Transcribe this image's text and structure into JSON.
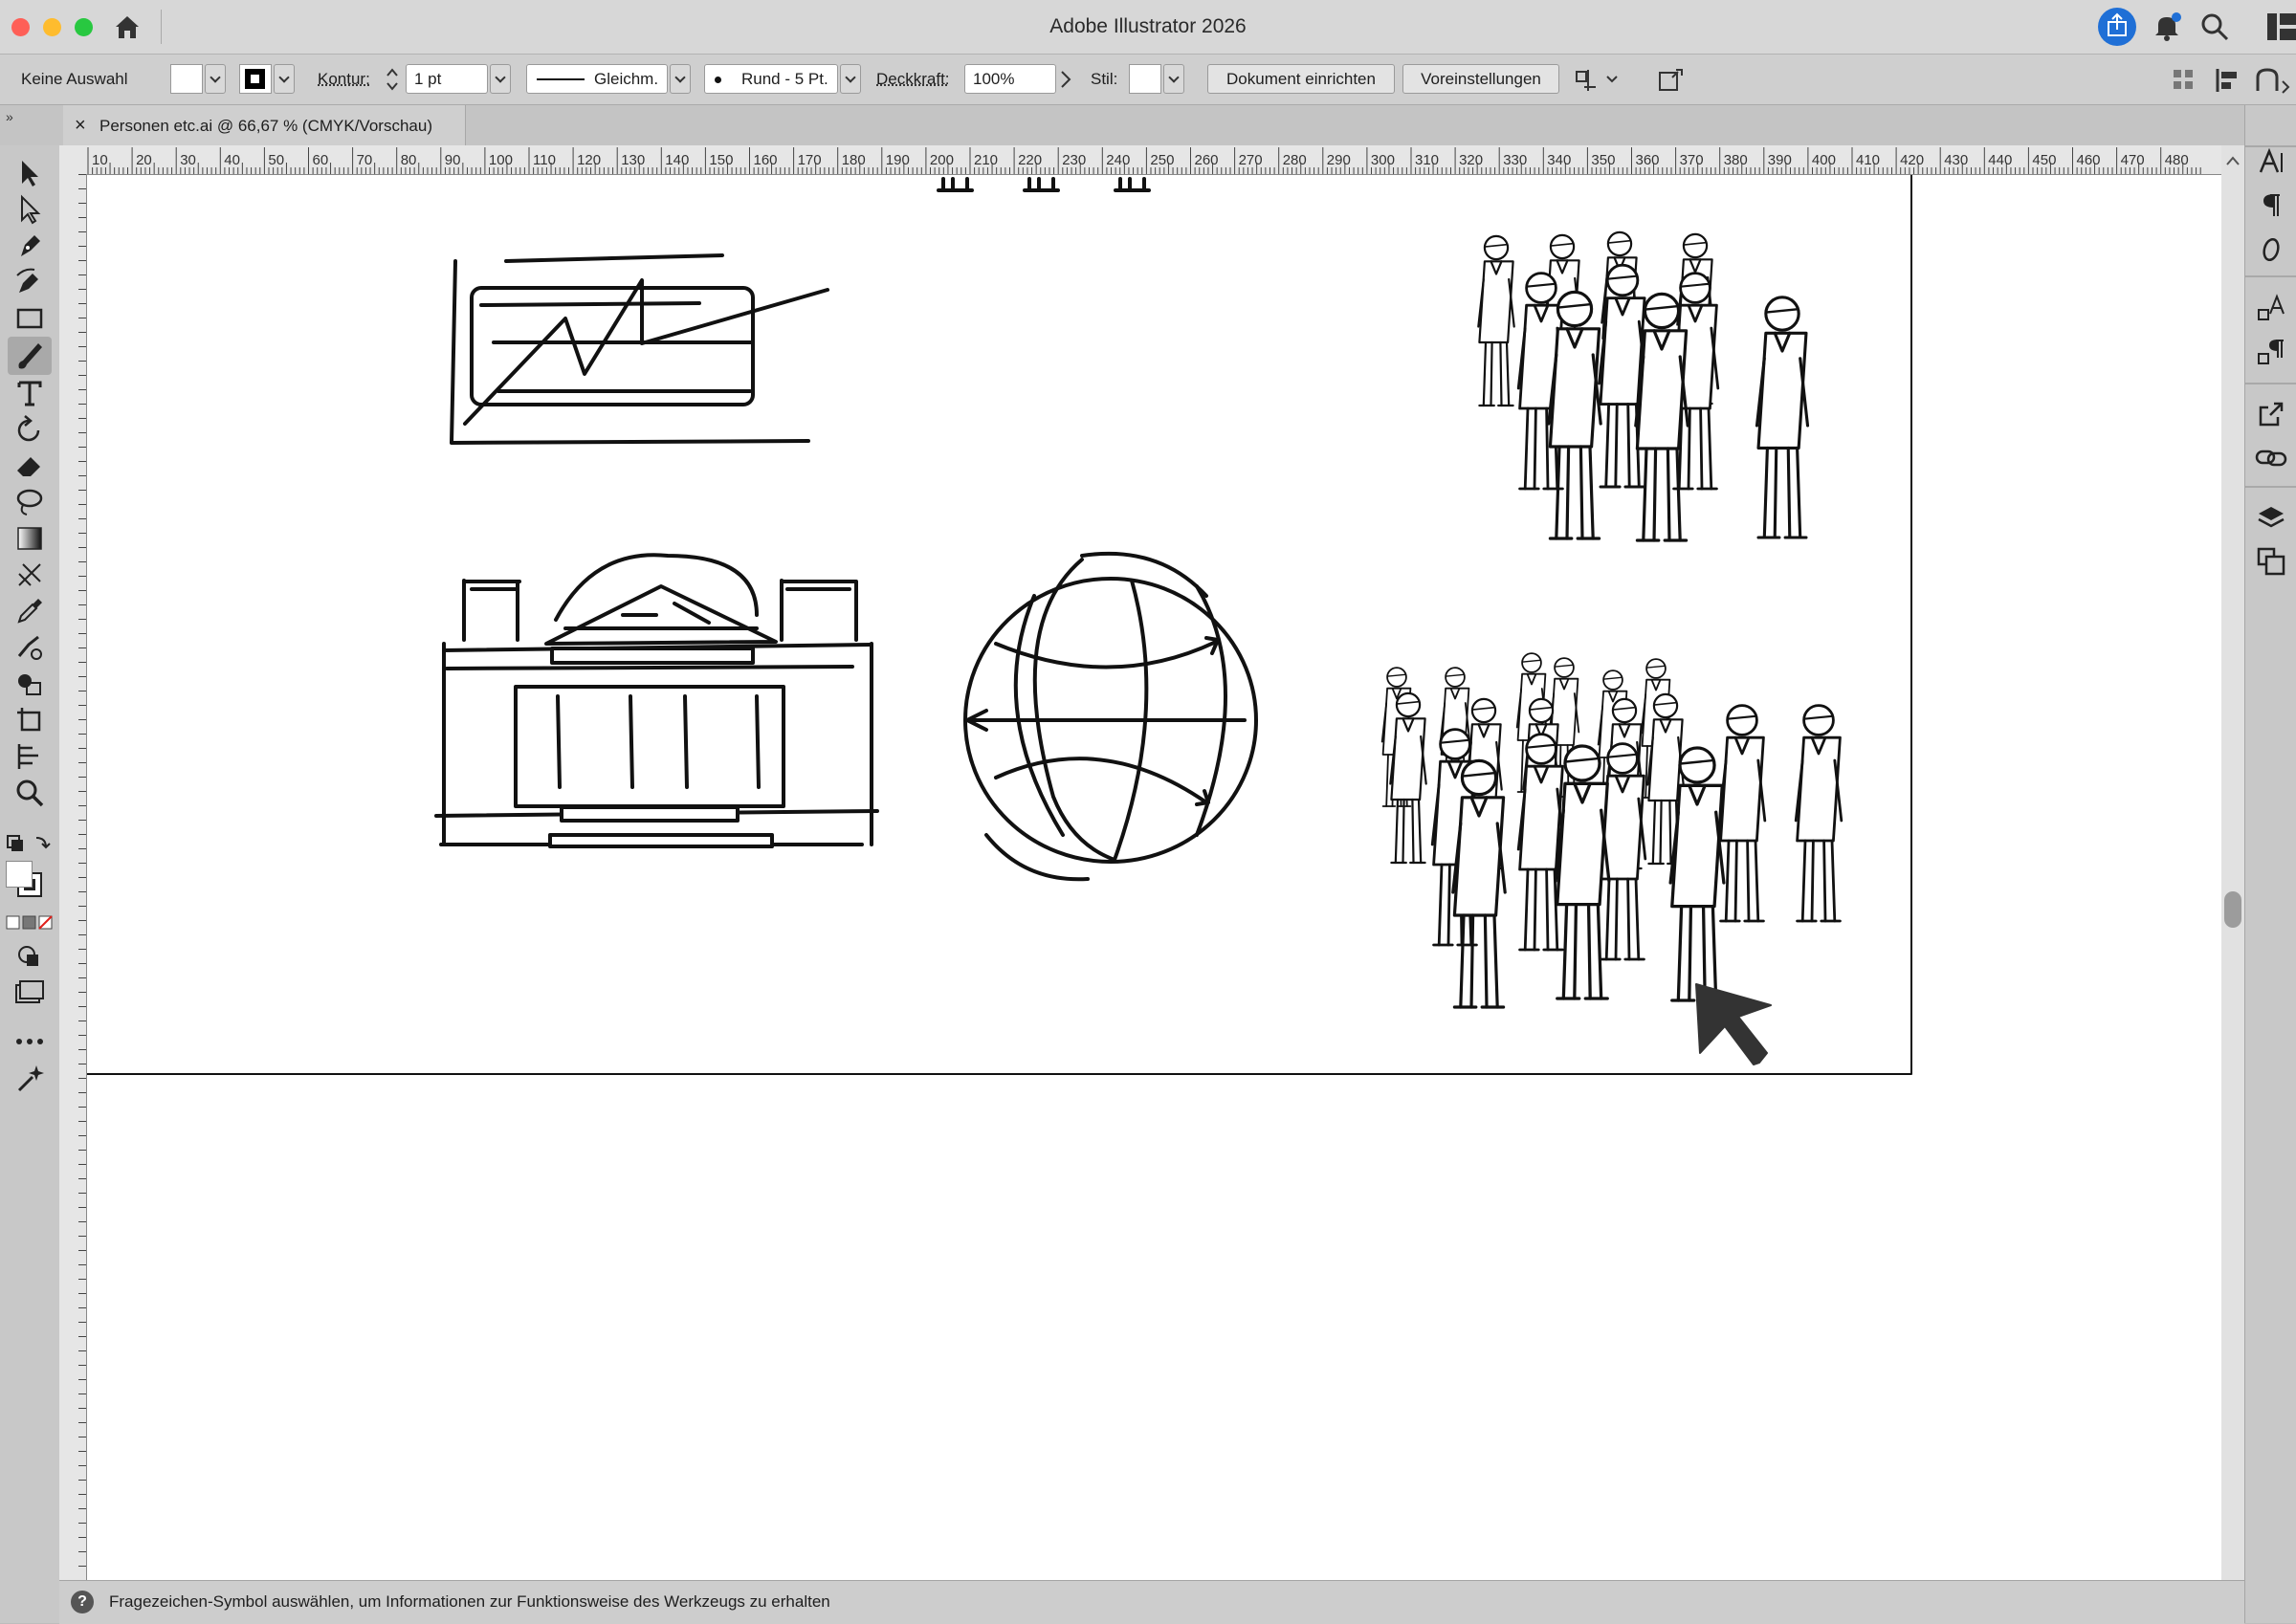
{
  "app": {
    "title": "Adobe Illustrator 2026"
  },
  "colors": {
    "close": "#fe5f57",
    "minimize": "#febc2e",
    "zoom": "#28c840",
    "accent": "#1f6fd6"
  },
  "controlbar": {
    "selection": "Keine Auswahl",
    "stroke_label": "Kontur:",
    "stroke_weight": "1 pt",
    "stroke_profile": "Gleichm.",
    "brush": "Rund - 5 Pt.",
    "opacity_label": "Deckkraft:",
    "opacity_value": "100%",
    "style_label": "Stil:",
    "document_setup_button": "Dokument einrichten",
    "preferences_button": "Voreinstellungen"
  },
  "document": {
    "tab_title": "Personen etc.ai @ 66,67 % (CMYK/Vorschau)",
    "close_glyph": "×"
  },
  "ruler": {
    "top_labels": [
      "10",
      "20",
      "30",
      "40",
      "50",
      "60",
      "70",
      "80",
      "90",
      "100",
      "110",
      "120",
      "130",
      "140",
      "150",
      "160",
      "170",
      "180",
      "190",
      "200",
      "210",
      "220",
      "230",
      "240",
      "250",
      "260",
      "270",
      "280",
      "290",
      "300",
      "310",
      "320",
      "330",
      "340",
      "350",
      "360",
      "370",
      "380",
      "390",
      "400",
      "410",
      "420",
      "430",
      "440",
      "450",
      "460",
      "470",
      "480"
    ]
  },
  "statusbar": {
    "help_icon_glyph": "?",
    "message": "Fragezeichen-Symbol auswählen, um Informationen zur Funktionsweise des Werkzeugs zu erhalten"
  },
  "tools": [
    "selection-tool",
    "direct-selection-tool",
    "pen-tool",
    "curvature-tool",
    "rectangle-tool",
    "paintbrush-tool",
    "type-tool",
    "rotate-tool",
    "eraser-tool",
    "lasso-tool",
    "gradient-tool",
    "mesh-tool",
    "eyedropper-tool",
    "blend-tool",
    "shape-builder-tool",
    "artboard-tool",
    "slice-tool",
    "zoom-tool"
  ],
  "panels": [
    "character-panel",
    "paragraph-panel",
    "opentype-panel",
    "character-styles-panel",
    "paragraph-styles-panel",
    "export-panel",
    "links-panel",
    "layers-panel",
    "artboards-panel"
  ]
}
